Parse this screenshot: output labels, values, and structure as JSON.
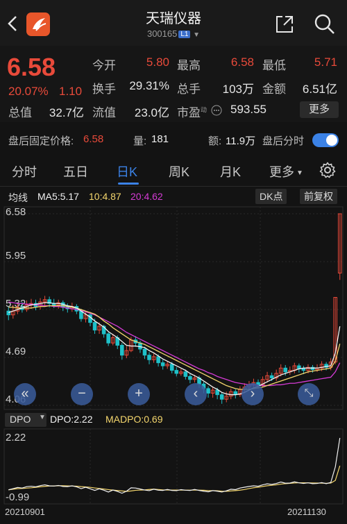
{
  "header": {
    "title": "天瑞仪器",
    "code": "300165",
    "badge": "L1"
  },
  "quote": {
    "price": "6.58",
    "change_pct": "20.07%",
    "change": "1.10",
    "rows": [
      [
        {
          "label": "今开",
          "value": "5.80",
          "color": "red"
        },
        {
          "label": "最高",
          "value": "6.58",
          "color": "red"
        },
        {
          "label": "最低",
          "value": "5.71",
          "color": "red"
        }
      ],
      [
        {
          "label": "换手",
          "value": "29.31%",
          "color": "white"
        },
        {
          "label": "总手",
          "value": "103万",
          "color": "white"
        },
        {
          "label": "金额",
          "value": "6.51亿",
          "color": "white"
        }
      ],
      [
        {
          "label": "总值",
          "value": "32.7亿",
          "color": "white"
        },
        {
          "label": "流值",
          "value": "23.0亿",
          "color": "white"
        },
        {
          "label": "市盈",
          "value": "593.55",
          "color": "white"
        }
      ]
    ],
    "pe_superscript": "动",
    "more_label": "更多"
  },
  "after_hours": {
    "price_label": "盘后固定价格:",
    "price_value": "6.58",
    "volume_label": "量:",
    "volume_value": "181",
    "amount_label": "额:",
    "amount_value": "11.9万",
    "timeshare_label": "盘后分时",
    "toggle_on": true
  },
  "tabs": [
    "分时",
    "五日",
    "日K",
    "周K",
    "月K",
    "更多"
  ],
  "active_tab": "日K",
  "legend": {
    "ma_label": "均线",
    "ma5": "MA5:5.17",
    "ma10": "10:4.87",
    "ma20": "20:4.62",
    "dk_label": "DK点",
    "adjust_label": "前复权"
  },
  "chart_data": {
    "type": "candlestick",
    "y_ticks": [
      "6.58",
      "5.95",
      "5.32",
      "4.69",
      "4.06"
    ],
    "ylim": [
      4.06,
      6.58
    ],
    "x_labels": [
      "20210901",
      "20211130"
    ],
    "candles": [
      [
        5.3,
        5.25,
        5.36,
        5.18
      ],
      [
        5.25,
        5.3,
        5.38,
        5.2
      ],
      [
        5.3,
        5.35,
        5.4,
        5.26
      ],
      [
        5.35,
        5.32,
        5.42,
        5.28
      ],
      [
        5.32,
        5.38,
        5.44,
        5.29
      ],
      [
        5.38,
        5.4,
        5.46,
        5.33
      ],
      [
        5.4,
        5.36,
        5.45,
        5.31
      ],
      [
        5.36,
        5.42,
        5.47,
        5.32
      ],
      [
        5.42,
        5.45,
        5.5,
        5.37
      ],
      [
        5.45,
        5.4,
        5.49,
        5.35
      ],
      [
        5.4,
        5.38,
        5.46,
        5.34
      ],
      [
        5.38,
        5.41,
        5.45,
        5.33
      ],
      [
        5.41,
        5.35,
        5.44,
        5.3
      ],
      [
        5.35,
        5.33,
        5.4,
        5.28
      ],
      [
        5.33,
        5.36,
        5.41,
        5.29
      ],
      [
        5.36,
        5.3,
        5.39,
        5.26
      ],
      [
        5.3,
        5.2,
        5.33,
        5.16
      ],
      [
        5.2,
        5.25,
        5.3,
        5.15
      ],
      [
        5.25,
        5.15,
        5.27,
        5.1
      ],
      [
        5.15,
        5.05,
        5.2,
        5.0
      ],
      [
        5.05,
        5.1,
        5.15,
        5.0
      ],
      [
        5.1,
        5.0,
        5.12,
        4.95
      ],
      [
        5.0,
        4.88,
        5.02,
        4.84
      ],
      [
        4.88,
        4.95,
        5.0,
        4.85
      ],
      [
        4.95,
        4.85,
        4.98,
        4.8
      ],
      [
        4.85,
        4.72,
        4.88,
        4.66
      ],
      [
        4.72,
        4.78,
        4.84,
        4.68
      ],
      [
        4.78,
        4.92,
        4.96,
        4.76
      ],
      [
        4.92,
        4.88,
        4.97,
        4.83
      ],
      [
        4.88,
        4.8,
        4.91,
        4.75
      ],
      [
        4.8,
        4.72,
        4.83,
        4.67
      ],
      [
        4.72,
        4.66,
        4.76,
        4.6
      ],
      [
        4.66,
        4.7,
        4.74,
        4.62
      ],
      [
        4.7,
        4.62,
        4.73,
        4.57
      ],
      [
        4.62,
        4.58,
        4.66,
        4.53
      ],
      [
        4.58,
        4.6,
        4.64,
        4.54
      ],
      [
        4.6,
        4.52,
        4.63,
        4.48
      ],
      [
        4.52,
        4.48,
        4.56,
        4.44
      ],
      [
        4.48,
        4.5,
        4.54,
        4.45
      ],
      [
        4.5,
        4.44,
        4.53,
        4.4
      ],
      [
        4.44,
        4.4,
        4.47,
        4.35
      ],
      [
        4.4,
        4.42,
        4.46,
        4.36
      ],
      [
        4.42,
        4.34,
        4.45,
        4.29
      ],
      [
        4.34,
        4.28,
        4.37,
        4.22
      ],
      [
        4.28,
        4.22,
        4.31,
        4.16
      ],
      [
        4.22,
        4.26,
        4.3,
        4.16
      ],
      [
        4.26,
        4.2,
        4.29,
        4.14
      ],
      [
        4.2,
        4.14,
        4.23,
        4.08
      ],
      [
        4.14,
        4.18,
        4.24,
        4.1
      ],
      [
        4.18,
        4.24,
        4.28,
        4.14
      ],
      [
        4.24,
        4.2,
        4.27,
        4.15
      ],
      [
        4.2,
        4.27,
        4.31,
        4.17
      ],
      [
        4.27,
        4.3,
        4.35,
        4.22
      ],
      [
        4.3,
        4.33,
        4.38,
        4.26
      ],
      [
        4.33,
        4.36,
        4.41,
        4.28
      ],
      [
        4.36,
        4.33,
        4.4,
        4.28
      ],
      [
        4.33,
        4.4,
        4.44,
        4.3
      ],
      [
        4.4,
        4.45,
        4.5,
        4.36
      ],
      [
        4.45,
        4.42,
        4.49,
        4.38
      ],
      [
        4.42,
        4.48,
        4.53,
        4.38
      ],
      [
        4.48,
        4.55,
        4.6,
        4.44
      ],
      [
        4.55,
        4.5,
        4.59,
        4.45
      ],
      [
        4.5,
        4.52,
        4.57,
        4.46
      ],
      [
        4.52,
        4.58,
        4.62,
        4.48
      ],
      [
        4.58,
        4.54,
        4.61,
        4.49
      ],
      [
        4.54,
        4.52,
        4.58,
        4.47
      ],
      [
        4.52,
        4.56,
        4.6,
        4.48
      ],
      [
        4.56,
        4.53,
        4.59,
        4.49
      ],
      [
        4.53,
        4.55,
        4.6,
        4.5
      ],
      [
        4.55,
        4.6,
        4.64,
        4.51
      ],
      [
        4.6,
        4.56,
        4.63,
        4.52
      ],
      [
        4.56,
        4.63,
        4.68,
        4.52
      ],
      [
        4.63,
        5.48,
        5.48,
        4.6
      ],
      [
        5.8,
        6.58,
        6.58,
        5.71
      ]
    ],
    "ma5": [
      5.28,
      5.3,
      5.32,
      5.34,
      5.36,
      5.38,
      5.39,
      5.4,
      5.41,
      5.41,
      5.4,
      5.4,
      5.39,
      5.37,
      5.36,
      5.34,
      5.3,
      5.26,
      5.22,
      5.17,
      5.13,
      5.09,
      5.03,
      4.99,
      4.95,
      4.9,
      4.85,
      4.84,
      4.84,
      4.83,
      4.82,
      4.78,
      4.75,
      4.71,
      4.67,
      4.64,
      4.61,
      4.58,
      4.55,
      4.52,
      4.48,
      4.45,
      4.42,
      4.38,
      4.34,
      4.3,
      4.27,
      4.23,
      4.21,
      4.2,
      4.2,
      4.21,
      4.23,
      4.26,
      4.29,
      4.31,
      4.34,
      4.37,
      4.4,
      4.43,
      4.46,
      4.48,
      4.5,
      4.52,
      4.54,
      4.55,
      4.55,
      4.55,
      4.55,
      4.56,
      4.57,
      4.58,
      4.75,
      5.1
    ],
    "ma10": [
      5.35,
      5.35,
      5.34,
      5.34,
      5.34,
      5.34,
      5.35,
      5.36,
      5.36,
      5.37,
      5.37,
      5.37,
      5.37,
      5.36,
      5.35,
      5.34,
      5.32,
      5.3,
      5.28,
      5.26,
      5.22,
      5.17,
      5.13,
      5.08,
      5.04,
      5.0,
      4.96,
      4.92,
      4.9,
      4.88,
      4.86,
      4.83,
      4.8,
      4.77,
      4.74,
      4.71,
      4.68,
      4.65,
      4.62,
      4.59,
      4.56,
      4.53,
      4.5,
      4.47,
      4.44,
      4.41,
      4.38,
      4.35,
      4.32,
      4.3,
      4.28,
      4.27,
      4.27,
      4.27,
      4.28,
      4.29,
      4.3,
      4.32,
      4.34,
      4.36,
      4.38,
      4.4,
      4.42,
      4.44,
      4.46,
      4.48,
      4.5,
      4.51,
      4.52,
      4.53,
      4.54,
      4.55,
      4.64,
      4.87
    ],
    "ma20": [
      5.42,
      5.41,
      5.4,
      5.4,
      5.39,
      5.39,
      5.38,
      5.38,
      5.37,
      5.37,
      5.36,
      5.36,
      5.35,
      5.34,
      5.33,
      5.32,
      5.31,
      5.29,
      5.27,
      5.25,
      5.22,
      5.19,
      5.16,
      5.13,
      5.1,
      5.06,
      5.02,
      4.99,
      4.96,
      4.93,
      4.9,
      4.87,
      4.84,
      4.81,
      4.78,
      4.75,
      4.72,
      4.69,
      4.66,
      4.63,
      4.6,
      4.57,
      4.54,
      4.52,
      4.49,
      4.47,
      4.44,
      4.42,
      4.4,
      4.38,
      4.36,
      4.35,
      4.34,
      4.33,
      4.33,
      4.32,
      4.32,
      4.32,
      4.32,
      4.33,
      4.33,
      4.34,
      4.35,
      4.35,
      4.36,
      4.37,
      4.38,
      4.39,
      4.4,
      4.41,
      4.42,
      4.43,
      4.5,
      4.62
    ]
  },
  "indicator": {
    "name": "DPO",
    "dpo": "DPO:2.22",
    "madpo": "MADPO:0.69",
    "y_top": "2.22",
    "y_bottom": "-0.99"
  },
  "colors": {
    "up": "#e84a3a",
    "down": "#1fc1c9",
    "ma5": "#f2f2f2",
    "ma10": "#f5d76e",
    "ma20": "#d63bd6",
    "accent": "#3b82e6"
  }
}
